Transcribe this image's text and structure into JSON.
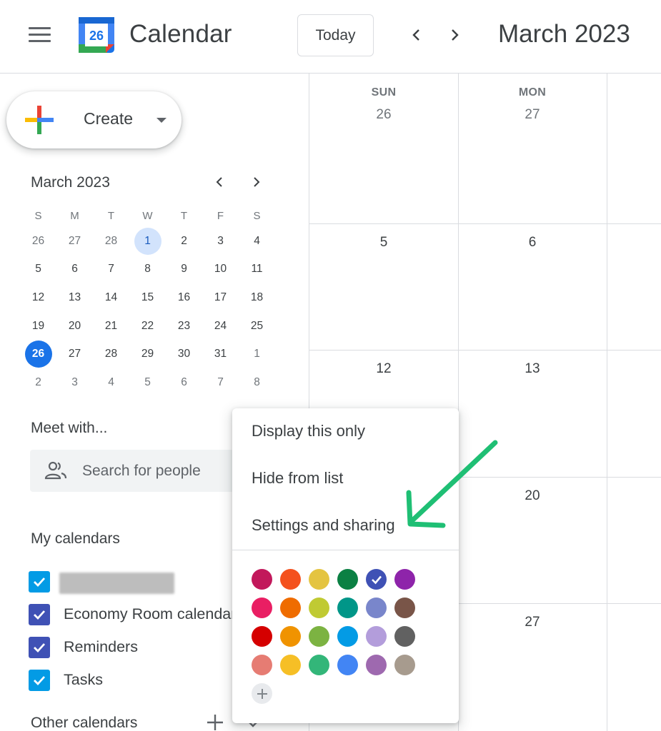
{
  "header": {
    "app_title": "Calendar",
    "logo_day": "26",
    "today_label": "Today",
    "month_title": "March 2023"
  },
  "sidebar": {
    "create_label": "Create",
    "mini_calendar": {
      "title": "March 2023",
      "weekdays": [
        "S",
        "M",
        "T",
        "W",
        "T",
        "F",
        "S"
      ],
      "weeks": [
        [
          "26",
          "27",
          "28",
          "1",
          "2",
          "3",
          "4"
        ],
        [
          "5",
          "6",
          "7",
          "8",
          "9",
          "10",
          "11"
        ],
        [
          "12",
          "13",
          "14",
          "15",
          "16",
          "17",
          "18"
        ],
        [
          "19",
          "20",
          "21",
          "22",
          "23",
          "24",
          "25"
        ],
        [
          "26",
          "27",
          "28",
          "29",
          "30",
          "31",
          "1"
        ],
        [
          "2",
          "3",
          "4",
          "5",
          "6",
          "7",
          "8"
        ]
      ],
      "selected_day": "1",
      "today": "26"
    },
    "meet_title": "Meet with...",
    "search_placeholder": "Search for people",
    "my_calendars_title": "My calendars",
    "my_calendars": [
      {
        "label": "",
        "color": "#039be5",
        "checked": true
      },
      {
        "label": "Economy Room calendar",
        "color": "#3f51b5",
        "checked": true
      },
      {
        "label": "Reminders",
        "color": "#3f51b5",
        "checked": true
      },
      {
        "label": "Tasks",
        "color": "#039be5",
        "checked": true
      }
    ],
    "other_calendars_title": "Other calendars"
  },
  "grid": {
    "day_headers": [
      "SUN",
      "MON"
    ],
    "weeks": [
      [
        "26",
        "27"
      ],
      [
        "5",
        "6"
      ],
      [
        "12",
        "13"
      ],
      [
        "",
        "20"
      ],
      [
        "",
        "27"
      ]
    ]
  },
  "context_menu": {
    "items": [
      "Display this only",
      "Hide from list",
      "Settings and sharing"
    ],
    "colors": [
      [
        "#c2185b",
        "#f4511e",
        "#e4c441",
        "#0b8043",
        "#3f51b5",
        "#8e24aa"
      ],
      [
        "#e91e63",
        "#ef6c00",
        "#c0ca33",
        "#009688",
        "#7986cb",
        "#795548"
      ],
      [
        "#d50000",
        "#f09300",
        "#7cb342",
        "#039be5",
        "#b39ddb",
        "#616161"
      ],
      [
        "#e67c73",
        "#f6bf26",
        "#33b679",
        "#4285f4",
        "#9e69af",
        "#a79b8e"
      ]
    ],
    "selected_color": "#3f51b5"
  },
  "annotation": {
    "arrow_color": "#1fbf74"
  }
}
